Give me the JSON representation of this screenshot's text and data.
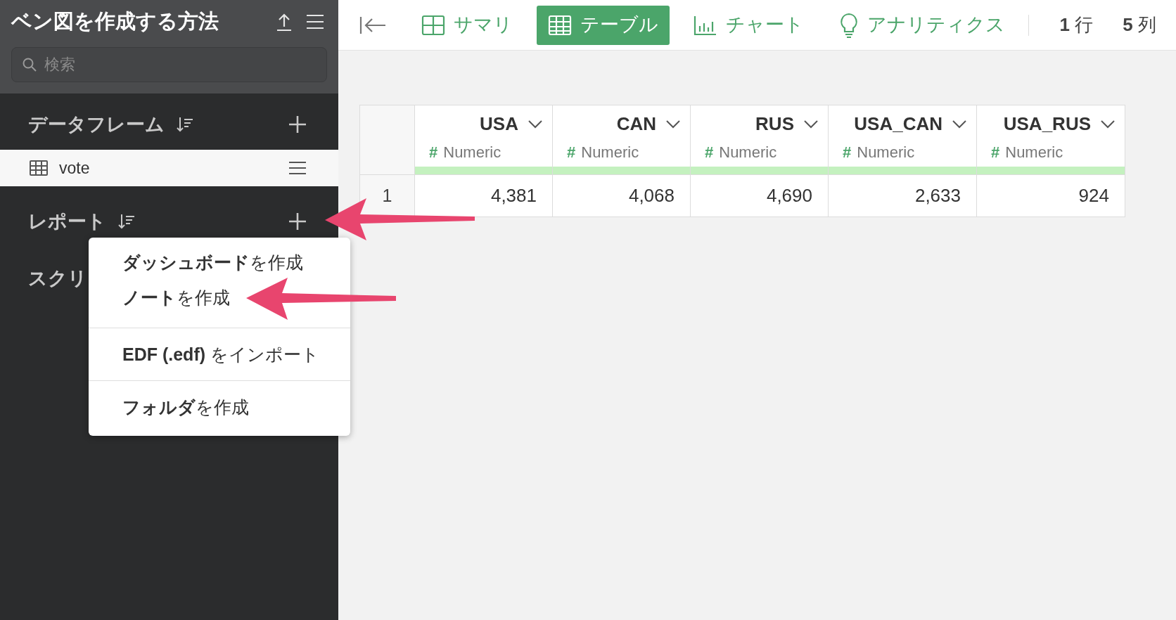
{
  "sidebar": {
    "title": "ベン図を作成する方法",
    "search": {
      "placeholder": "検索"
    },
    "sections": [
      {
        "title": "データフレーム",
        "items": [
          {
            "name": "vote",
            "selected": true
          }
        ]
      },
      {
        "title": "レポート"
      },
      {
        "title": "スクリ"
      }
    ]
  },
  "menu": {
    "groups": [
      [
        "**ダッシュボード**を作成",
        "**ノート**を作成"
      ],
      [
        "**EDF (.edf)** をインポート"
      ],
      [
        "**フォルダ**を作成"
      ]
    ]
  },
  "toolbar": {
    "tabs": [
      {
        "label": "サマリ",
        "kind": "summary",
        "selected": false
      },
      {
        "label": "テーブル",
        "kind": "table",
        "selected": true
      },
      {
        "label": "チャート",
        "kind": "chart",
        "selected": false
      },
      {
        "label": "アナリティクス",
        "kind": "analytics",
        "selected": false
      }
    ],
    "rows": "**1** 行",
    "columns": "**5** 列"
  },
  "table": {
    "columns": [
      {
        "name": "USA",
        "type_mark": "#",
        "type": "Numeric"
      },
      {
        "name": "CAN",
        "type_mark": "#",
        "type": "Numeric"
      },
      {
        "name": "RUS",
        "type_mark": "#",
        "type": "Numeric"
      },
      {
        "name": "USA_CAN",
        "type_mark": "#",
        "type": "Numeric"
      },
      {
        "name": "USA_RUS",
        "type_mark": "#",
        "type": "Numeric"
      }
    ],
    "rows": [
      {
        "index": "1",
        "cells": [
          "4,381",
          "4,068",
          "4,690",
          "2,633",
          "924"
        ]
      }
    ]
  }
}
